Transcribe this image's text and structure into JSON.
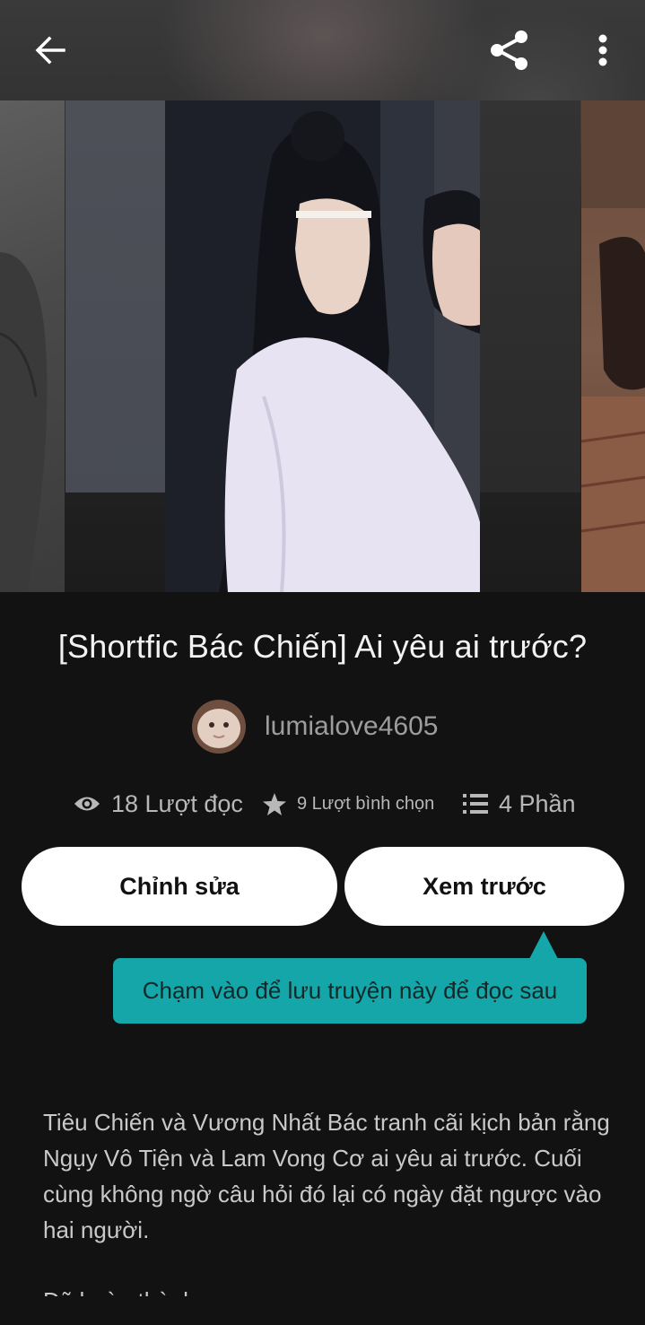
{
  "topbar": {
    "back_icon": "arrow-left-icon",
    "share_icon": "share-icon",
    "more_icon": "more-vertical-icon"
  },
  "story": {
    "title": "[Shortfic Bác Chiến] Ai yêu ai trước?",
    "author": "lumialove4605",
    "stats": {
      "reads": "18 Lượt đọc",
      "votes": "9 Lượt bình chọn",
      "parts": "4 Phần"
    },
    "description": "Tiêu Chiến và Vương Nhất Bác tranh cãi kịch bản rằng Ngụy Vô Tiện và Lam Vong Cơ ai yêu ai trước. Cuối cùng không ngờ câu hỏi đó lại có ngày đặt ngược vào hai người.",
    "status": "Đã hoàn thành"
  },
  "actions": {
    "edit_label": "Chỉnh sửa",
    "preview_label": "Xem trước"
  },
  "tooltip": {
    "text": "Chạm vào để lưu truyện này để đọc sau"
  },
  "colors": {
    "background": "#121212",
    "accent_teal": "#14a6a8",
    "button_bg": "#ffffff"
  }
}
